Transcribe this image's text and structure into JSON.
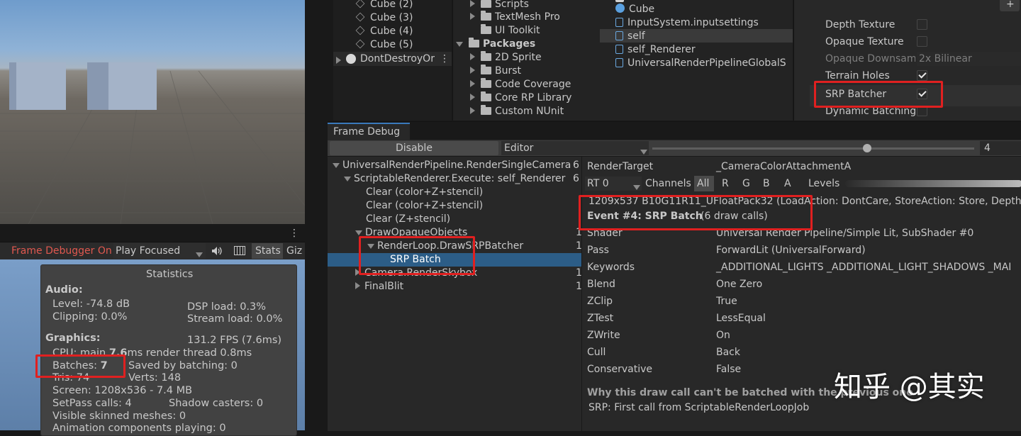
{
  "hierarchy": {
    "items": [
      "Cube (2)",
      "Cube (3)",
      "Cube (4)",
      "Cube (5)"
    ],
    "dontdestroy": "DontDestroyOr"
  },
  "project": {
    "folders": [
      "Scripts",
      "TextMesh Pro",
      "UI Toolkit"
    ],
    "packages_label": "Packages",
    "packages": [
      "2D Sprite",
      "Burst",
      "Code Coverage",
      "Core RP Library",
      "Custom NUnit"
    ]
  },
  "assets": {
    "items": [
      "Cube",
      "InputSystem.inputsettings",
      "self",
      "self_Renderer",
      "UniversalRenderPipelineGlobalS"
    ]
  },
  "urp": {
    "rows": [
      {
        "label": "Depth Texture",
        "checked": false
      },
      {
        "label": "Opaque Texture",
        "checked": false
      },
      {
        "label": "Opaque Downsam",
        "value": "2x Bilinear"
      },
      {
        "label": "Terrain Holes",
        "checked": true
      },
      {
        "label": "SRP Batcher",
        "checked": true
      },
      {
        "label": "Dynamic Batching",
        "checked": false
      }
    ],
    "plus": "+"
  },
  "gameview": {
    "frame_debugger_label": "Frame Debugger On",
    "play_focused": "Play Focused",
    "stats_btn": "Stats",
    "gizmos_btn": "Giz"
  },
  "stats": {
    "title": "Statistics",
    "audio_header": "Audio:",
    "level": "Level: -74.8 dB",
    "clipping": "Clipping: 0.0%",
    "dsp": "DSP load: 0.3%",
    "stream": "Stream load: 0.0%",
    "graphics_header": "Graphics:",
    "fps": "131.2 FPS (7.6ms)",
    "cpu_prefix": "CPU: main ",
    "cpu_ms": "7.6",
    "cpu_suffix": "ms  render thread 0.8ms",
    "batches_prefix": "Batches: ",
    "batches_value": "7",
    "saved": "Saved by batching: 0",
    "tris": "Tris: 74",
    "verts": "Verts: 148",
    "screen": "Screen: 1208x536 - 7.4 MB",
    "setpass": "SetPass calls: 4",
    "shadow": "Shadow casters: 0",
    "skinned": "Visible skinned meshes: 0",
    "animation": "Animation components playing: 0"
  },
  "frame_debug": {
    "tab": "Frame Debug",
    "disable_btn": "Disable",
    "target": "Editor",
    "slider_value": 4,
    "slider_max": 6,
    "tree": [
      {
        "label": "UniversalRenderPipeline.RenderSingleCamera",
        "count": "6"
      },
      {
        "label": "ScriptableRenderer.Execute: self_Renderer",
        "count": "6"
      },
      {
        "label": "Clear (color+Z+stencil)",
        "count": ""
      },
      {
        "label": "Clear (color+Z+stencil)",
        "count": ""
      },
      {
        "label": "Clear (Z+stencil)",
        "count": ""
      },
      {
        "label": "DrawOpaqueObjects",
        "count": "1"
      },
      {
        "label": "RenderLoop.DrawSRPBatcher",
        "count": "1"
      },
      {
        "label": "SRP Batch",
        "count": ""
      },
      {
        "label": "Camera.RenderSkybox",
        "count": "1"
      },
      {
        "label": "FinalBlit",
        "count": "1"
      }
    ],
    "render_target_label": "RenderTarget",
    "render_target_value": "_CameraColorAttachmentA",
    "rt_select": "RT 0",
    "channels_label": "Channels",
    "channels": [
      "All",
      "R",
      "G",
      "B",
      "A"
    ],
    "levels_label": "Levels",
    "format_line": "1209x537 B10G11R11_UFloatPack32 (LoadAction: DontCare, StoreAction: Store, Depth",
    "event_title": "Event #4: SRP Batch",
    "event_calls": "(6 draw calls)",
    "props": [
      {
        "k": "Shader",
        "v": "Universal Render Pipeline/Simple Lit, SubShader #0"
      },
      {
        "k": "Pass",
        "v": "ForwardLit (UniversalForward)"
      },
      {
        "k": "Keywords",
        "v": "_ADDITIONAL_LIGHTS _ADDITIONAL_LIGHT_SHADOWS _MAI"
      },
      {
        "k": "Blend",
        "v": "One Zero"
      },
      {
        "k": "ZClip",
        "v": "True"
      },
      {
        "k": "ZTest",
        "v": "LessEqual"
      },
      {
        "k": "ZWrite",
        "v": "On"
      },
      {
        "k": "Cull",
        "v": "Back"
      },
      {
        "k": "Conservative",
        "v": "False"
      }
    ],
    "why_title": "Why this draw call can't be batched with the previous one",
    "why_text": "SRP: First call from ScriptableRenderLoopJob"
  },
  "watermark": "知乎 @其实",
  "colors": {
    "highlight": "#e02020",
    "selection": "#2c5d87",
    "frame_debugger_on": "#e0584f"
  }
}
